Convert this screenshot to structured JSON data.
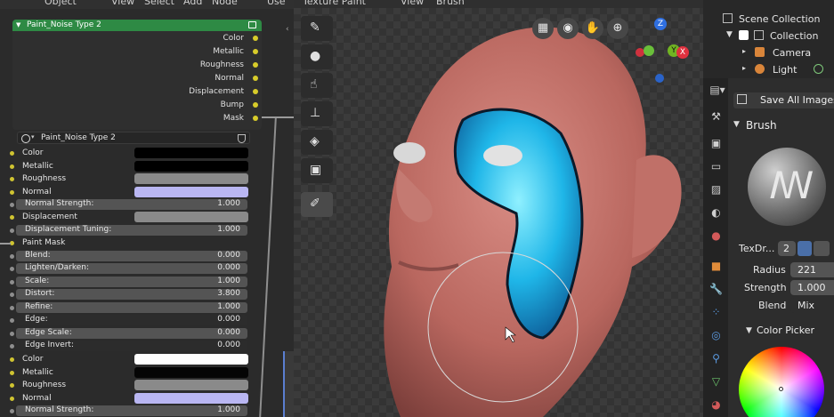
{
  "top_menu": [
    "Object",
    "View",
    "Select",
    "Add",
    "Node",
    "Use N"
  ],
  "node": {
    "title": "Paint_Noise Type 2",
    "outputs": [
      "Color",
      "Metallic",
      "Roughness",
      "Normal",
      "Displacement",
      "Bump",
      "Mask"
    ]
  },
  "material_slot": {
    "name": "Paint_Noise Type 2"
  },
  "properties": {
    "color": "Color",
    "metallic": "Metallic",
    "roughness": "Roughness",
    "normal": "Normal",
    "normal_strength": {
      "label": "Normal Strength:",
      "value": "1.000"
    },
    "displacement": "Displacement",
    "displacement_tuning": {
      "label": "Displacement Tuning:",
      "value": "1.000"
    },
    "paint_mask": "Paint Mask",
    "blend": {
      "label": "Blend:",
      "value": "0.000"
    },
    "lighten_darken": {
      "label": "Lighten/Darken:",
      "value": "0.000"
    },
    "scale": {
      "label": "Scale:",
      "value": "1.000"
    },
    "distort": {
      "label": "Distort:",
      "value": "3.800"
    },
    "refine": {
      "label": "Refine:",
      "value": "1.000"
    },
    "edge": {
      "label": "Edge:",
      "value": "0.000"
    },
    "edge_scale": {
      "label": "Edge Scale:",
      "value": "0.000"
    },
    "edge_invert": {
      "label": "Edge Invert:",
      "value": "0.000"
    },
    "color2": "Color",
    "metallic2": "Metallic",
    "roughness2": "Roughness",
    "normal2": "Normal",
    "normal_strength2": {
      "label": "Normal Strength:",
      "value": "1.000"
    }
  },
  "swatches": {
    "color": "#000000",
    "metallic": "#000000",
    "roughness": "#8a8a8a",
    "normal": "#b9b6f2",
    "displacement": "#8a8a8a",
    "color2": "#ffffff",
    "metallic2": "#050505",
    "roughness2": "#8a8a8a",
    "normal2": "#b9b6f2"
  },
  "viewport": {
    "mode": "Texture Paint",
    "menu": [
      "View",
      "Brush"
    ],
    "gizmo": {
      "z": "Z",
      "y": "Y",
      "x": "X"
    }
  },
  "outliner": {
    "scene_collection": "Scene Collection",
    "collection": "Collection",
    "camera": "Camera",
    "light": "Light"
  },
  "brush_panel": {
    "save_all_images": "Save All Images",
    "brush_header": "Brush",
    "brush_name": "TexDr...",
    "users": "2",
    "radius_label": "Radius",
    "radius_value": "221",
    "strength_label": "Strength",
    "strength_value": "1.000",
    "blend_label": "Blend",
    "blend_value": "Mix",
    "color_picker": "Color Picker"
  }
}
